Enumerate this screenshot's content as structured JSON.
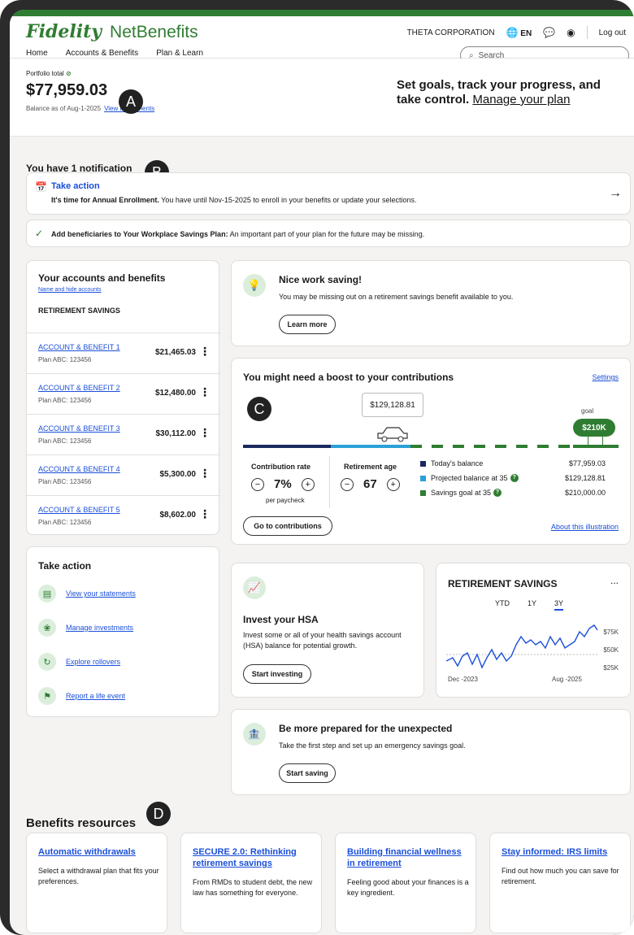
{
  "header": {
    "brand": "Fidelity",
    "product": "NetBenefits",
    "company": "THETA CORPORATION",
    "lang": "EN",
    "logout": "Log out"
  },
  "nav": {
    "items": [
      "Home",
      "Accounts & Benefits",
      "Plan & Learn"
    ]
  },
  "search": {
    "placeholder": "Search"
  },
  "portfolio": {
    "label": "Portfolio total",
    "value": "$77,959.03",
    "asof": "Balance as of Aug-1-2025",
    "view_link": "View investments"
  },
  "goals": {
    "text": "Set goals, track your progress, and take control.",
    "link": "Manage your plan"
  },
  "badges": {
    "a": "A",
    "b": "B",
    "c": "C",
    "d": "D"
  },
  "notifications": {
    "title": "You have 1 notification",
    "take_action": "Take action",
    "ta_bold": "It's time for Annual Enrollment.",
    "ta_text": "You have until Nov-15-2025 to enroll in your benefits or update your selections.",
    "benef_bold": "Add beneficiaries to Your Workplace Savings Plan:",
    "benef_text": "An important part of your plan for the future may be missing."
  },
  "accounts": {
    "title": "Your accounts and benefits",
    "hide_link": "Name and hide accounts",
    "section": "RETIREMENT SAVINGS",
    "rows": [
      {
        "name": "ACCOUNT & BENEFIT 1",
        "plan": "Plan ABC: 123456",
        "value": "$21,465.03"
      },
      {
        "name": "ACCOUNT & BENEFIT 2",
        "plan": "Plan ABC: 123456",
        "value": "$12,480.00"
      },
      {
        "name": "ACCOUNT & BENEFIT 3",
        "plan": "Plan ABC: 123456",
        "value": "$30,112.00"
      },
      {
        "name": "ACCOUNT & BENEFIT 4",
        "plan": "Plan ABC: 123456",
        "value": "$5,300.00"
      },
      {
        "name": "ACCOUNT & BENEFIT 5",
        "plan": "Plan ABC: 123456",
        "value": "$8,602.00"
      }
    ]
  },
  "take_action": {
    "title": "Take action",
    "items": [
      "View your statements",
      "Manage investments",
      "Explore rollovers",
      "Report a life event"
    ]
  },
  "nice_work": {
    "title": "Nice work saving!",
    "text": "You may be missing out on a retirement savings benefit available to you.",
    "button": "Learn more"
  },
  "boost": {
    "title": "You might need a boost to your contributions",
    "settings": "Settings",
    "tooltip": "$129,128.81",
    "goal_label": "goal",
    "goal_value": "$210K",
    "contrib_label": "Contribution rate",
    "contrib_value": "7%",
    "contrib_sub": "per paycheck",
    "age_label": "Retirement age",
    "age_value": "67",
    "legend": [
      {
        "label": "Today's balance",
        "value": "$77,959.03",
        "color": "#1b2a5e"
      },
      {
        "label": "Projected balance at 35",
        "value": "$129,128.81",
        "color": "#2b9fd8"
      },
      {
        "label": "Savings goal at 35",
        "value": "$210,000.00",
        "color": "#2f7d32"
      }
    ],
    "button": "Go to contributions",
    "about": "About this illustration"
  },
  "hsa": {
    "title": "Invest your HSA",
    "text": "Invest some or all of your health savings account (HSA) balance for potential growth.",
    "button": "Start investing"
  },
  "retirement": {
    "title": "RETIREMENT SAVINGS",
    "more": "...",
    "tabs": [
      "YTD",
      "1Y",
      "3Y"
    ],
    "active_tab": "3Y",
    "y_ticks": [
      "$75K",
      "$50K",
      "$25K"
    ],
    "x_start": "Dec -2023",
    "x_end": "Aug -2025"
  },
  "prepared": {
    "title": "Be more prepared for the unexpected",
    "text": "Take the first step and set up an emergency savings goal.",
    "button": "Start saving"
  },
  "resources": {
    "title": "Benefits resources",
    "cards": [
      {
        "title": "Automatic withdrawals",
        "text": "Select a withdrawal plan that fits your preferences."
      },
      {
        "title": "SECURE 2.0: Rethinking retirement savings",
        "text": "From RMDs to student debt, the new law has something for everyone."
      },
      {
        "title": "Building financial wellness in retirement",
        "text": "Feeling good about your finances is a key ingredient."
      },
      {
        "title": "Stay informed: IRS limits",
        "text": "Find out how much you can save for retirement."
      }
    ]
  }
}
